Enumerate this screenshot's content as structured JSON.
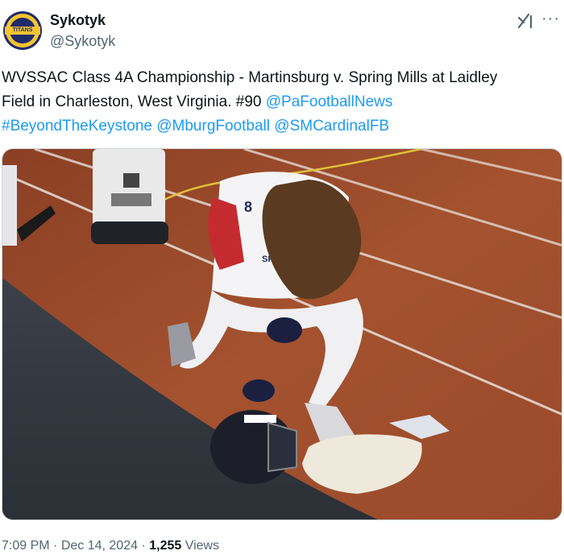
{
  "author": {
    "name": "Sykotyk",
    "handle": "@Sykotyk",
    "avatar_text": "TITANS",
    "avatar_icon": "team-logo-avatar"
  },
  "header_icons": {
    "grok": "grok-icon",
    "more": "more-options-icon",
    "more_glyph": "···"
  },
  "tweet": {
    "text_line1": "WVSSAC Class 4A Championship - Martinsburg v. Spring Mills at Laidley",
    "text_line2": "Field in Charleston, West Virginia. #90 ",
    "mention1": "@PaFootballNews",
    "hashtag": "#BeyondTheKeystone",
    "sep1": " ",
    "mention2": "@MburgFootball",
    "sep2": " ",
    "mention3": "@SMCardinalFB"
  },
  "photo": {
    "jersey_number": "8",
    "jersey_text": "SPRING MILLS"
  },
  "meta": {
    "time": "7:09 PM",
    "dot1": " · ",
    "date": "Dec 14, 2024",
    "dot2": " · ",
    "views_count": "1,255",
    "views_label": " Views"
  },
  "colors": {
    "link": "#1d9bf0",
    "secondary_text": "#536471",
    "track": "#9b4a2c",
    "turf": "#3a3e47"
  }
}
